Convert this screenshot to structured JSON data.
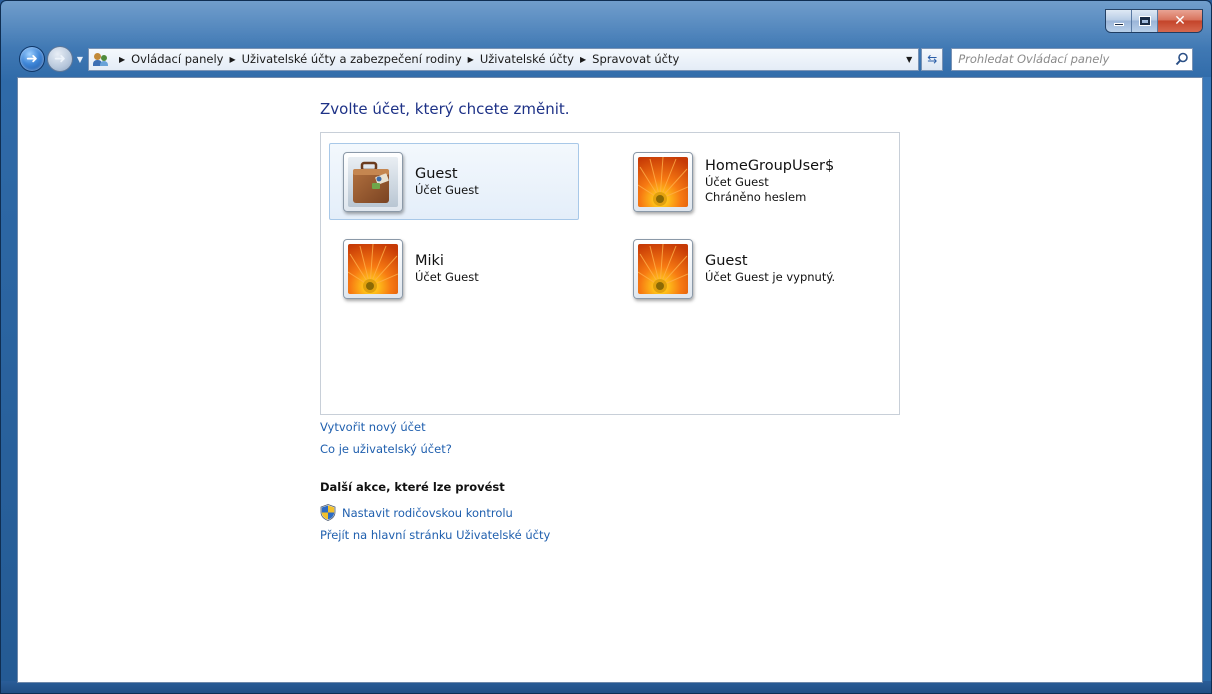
{
  "window": {
    "caption": {
      "minimize": "minimize-icon",
      "maximize": "maximize-icon",
      "close": "close-icon"
    }
  },
  "nav": {
    "breadcrumbs": [
      "Ovládací panely",
      "Uživatelské účty a zabezpečení rodiny",
      "Uživatelské účty",
      "Spravovat účty"
    ],
    "search_placeholder": "Prohledat Ovládací panely"
  },
  "main": {
    "heading": "Zvolte účet, který chcete změnit.",
    "accounts": [
      {
        "name": "Guest",
        "lines": [
          "Účet Guest"
        ],
        "picture": "briefcase",
        "selected": true
      },
      {
        "name": "HomeGroupUser$",
        "lines": [
          "Účet Guest",
          "Chráněno heslem"
        ],
        "picture": "orange-flower",
        "selected": false
      },
      {
        "name": "Miki",
        "lines": [
          "Účet Guest"
        ],
        "picture": "orange-flower",
        "selected": false
      },
      {
        "name": "Guest",
        "lines": [
          "Účet Guest je vypnutý."
        ],
        "picture": "orange-flower",
        "selected": false
      }
    ],
    "links": {
      "create_account": "Vytvořit nový účet",
      "what_is_account": "Co je uživatelský účet?"
    },
    "more_actions": {
      "title": "Další akce, které lze provést",
      "parental_controls": "Nastavit rodičovskou kontrolu",
      "main_page": "Přejít na hlavní stránku Uživatelské účty"
    }
  },
  "colors": {
    "link": "#1f5fae",
    "heading": "#1e3287",
    "frame": "#2f6aa8"
  }
}
